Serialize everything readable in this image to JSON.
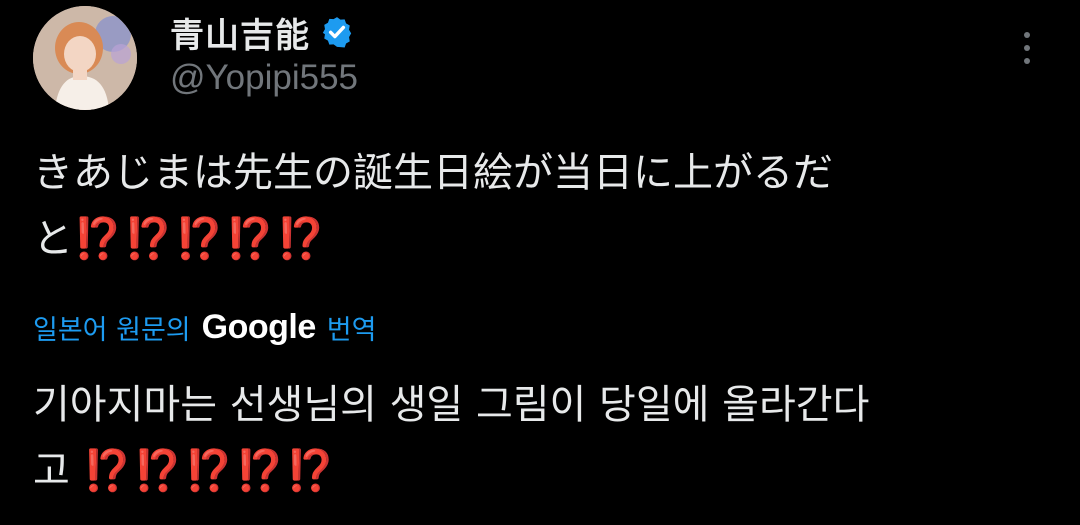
{
  "author": {
    "display_name": "青山吉能",
    "handle": "@Yopipi555",
    "verified": true,
    "verified_color": "#1d9bf0"
  },
  "icons": {
    "verified": "verified-badge-icon",
    "more": "more-vertical-icon"
  },
  "tweet": {
    "line1": "きあじまは先生の誕生日絵が当日に上がるだ",
    "line2_prefix": "と",
    "line2_emphasis": "⁉️⁉️⁉️⁉️⁉️"
  },
  "translation_bar": {
    "prefix": "일본어 원문의",
    "provider": "Google",
    "suffix": "번역",
    "link_color": "#1d9bf0"
  },
  "translation": {
    "line1": "기아지마는 선생님의 생일 그림이 당일에 올라간다",
    "line2_prefix": "고",
    "line2_emphasis": "⁉️⁉️⁉️⁉️⁉️"
  },
  "colors": {
    "background": "#000000",
    "text": "#e7e9ea",
    "secondary_text": "#71767b",
    "emphasis": "#e0212f"
  }
}
